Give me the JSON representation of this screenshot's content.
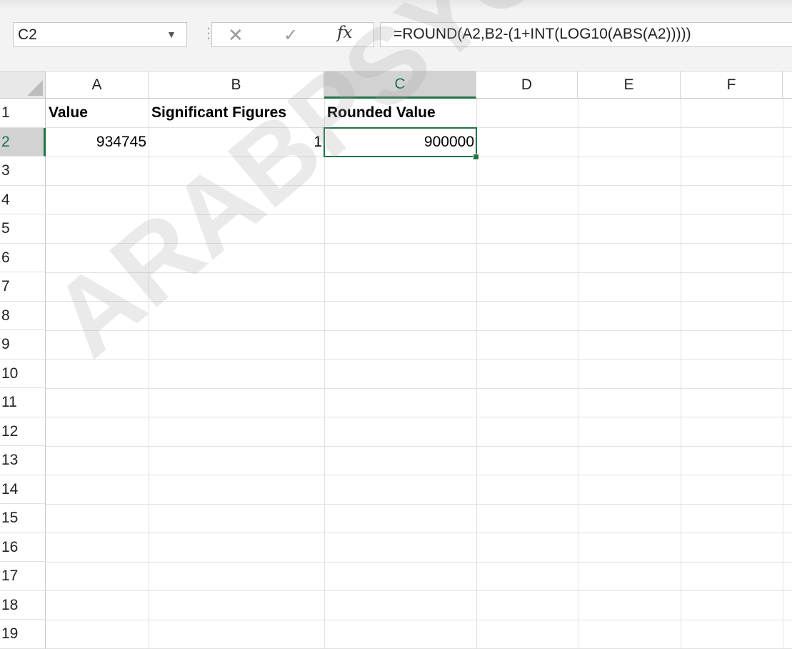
{
  "formula_bar": {
    "name_box": "C2",
    "cancel_icon": "✕",
    "enter_icon": "✓",
    "fx_label": "fx",
    "formula": "=ROUND(A2,B2-(1+INT(LOG10(ABS(A2)))))"
  },
  "columns": [
    "A",
    "B",
    "C",
    "D",
    "E",
    "F"
  ],
  "rows": [
    "1",
    "2",
    "3",
    "4",
    "5",
    "6",
    "7",
    "8",
    "9",
    "10",
    "11",
    "12",
    "13",
    "14",
    "15",
    "16",
    "17",
    "18",
    "19"
  ],
  "cells": {
    "A1": "Value",
    "B1": "Significant Figures",
    "C1": "Rounded Value",
    "A2": "934745",
    "B2": "1",
    "C2": "900000"
  },
  "selected_cell": "C2",
  "watermark": "ARABPSYCHOLOGY",
  "colors": {
    "selection": "#217346",
    "header_selected": "#d2d2d2",
    "grid": "#e1e1e1"
  }
}
